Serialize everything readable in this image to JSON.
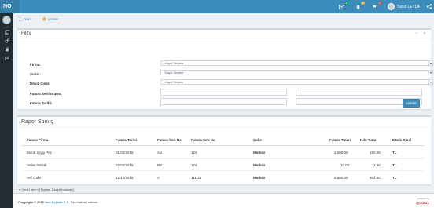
{
  "header": {
    "logo": "NO",
    "username": "Yusuf LEYLA",
    "badges": {
      "mail": "4",
      "notifications": "10",
      "tasks": "9"
    }
  },
  "tabs": [
    {
      "label": "Yeni",
      "icon": "new-document-icon"
    },
    {
      "label": "Listele",
      "icon": "list-icon"
    }
  ],
  "filter": {
    "title": "Filtre",
    "fields": {
      "firma_label": "Firma:",
      "firma_value": "Kayıt Seçiniz",
      "sube_label": "Şube :",
      "sube_value": "Kayıt Seçiniz",
      "doviz_label": "Döviz Cinsi:",
      "doviz_value": "Kayıt Seçiniz",
      "seri_label": "Fatura Seri/SıraNo:",
      "tarih_label": "Fatura Tarihi:"
    },
    "submit_label": "Listele",
    "tools": {
      "collapse": "−",
      "close": "×"
    }
  },
  "report": {
    "title": "Rapor Sonuç",
    "columns": [
      "Fatura Firma",
      "Fatura Tarihi",
      "Fatura Seri No",
      "Fatura Sıra No",
      "Şube",
      "Fatura Tutarı",
      "Kdv Tutarı",
      "Döviz Cinsi"
    ],
    "rows": [
      [
        "Murat Giyip Paz",
        "01/02/2016",
        "AB",
        "123",
        "Merkez",
        "1.000,00",
        "180,00",
        "TL"
      ],
      [
        "Selen Tekstil",
        "02/02/2016",
        "BB",
        "123",
        "Merkez",
        "10,00",
        "1,80",
        "TL"
      ],
      [
        "Arif Gıda",
        "12/12/2015",
        "A",
        "111111",
        "Merkez",
        "5.680,00",
        "854,40",
        "TL"
      ]
    ]
  },
  "pagination": {
    "text": "« Geri 1 İleri » [Toplam 3 kayıt bulundu]"
  },
  "footer": {
    "copyright": "Copyright © 2016",
    "company": "Neo Lojistik A.Ş.",
    "rights": "Tüm hakları saklıdır.",
    "powered_by": "powered by",
    "brand": "Qooboy"
  },
  "colors": {
    "header": "#3c8dbc",
    "sidebar": "#222d32",
    "accent": "#3c8dbc"
  }
}
